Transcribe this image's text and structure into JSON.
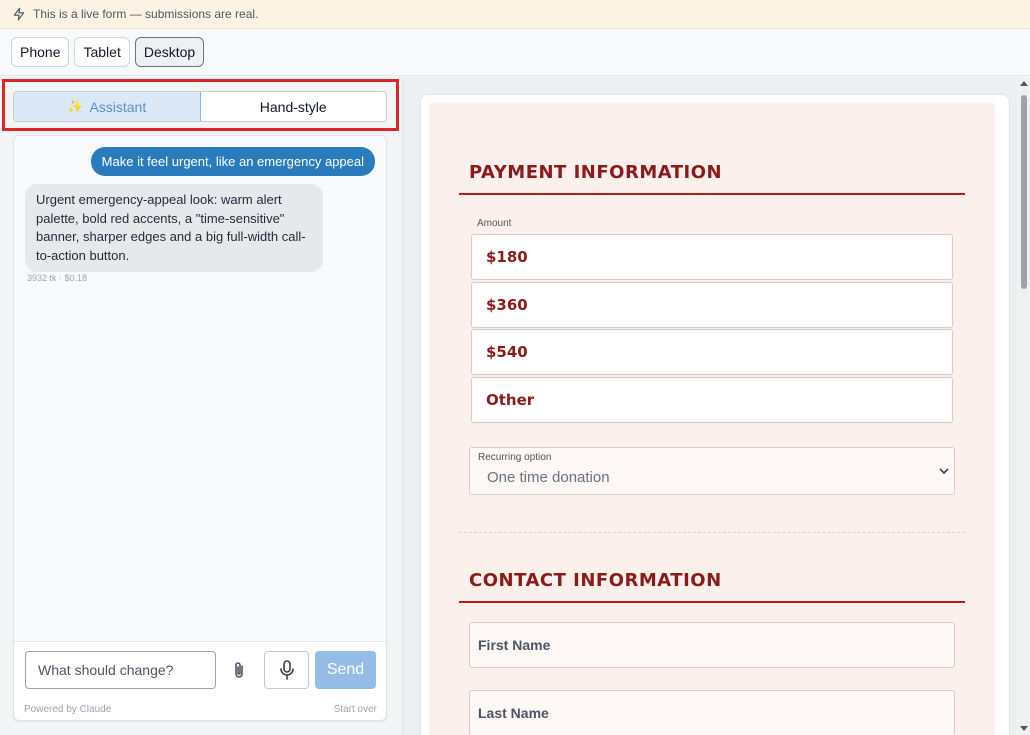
{
  "banner": {
    "icon": "bolt-icon",
    "text": "This is a live form — submissions are real."
  },
  "devices": [
    {
      "label": "Phone",
      "active": false
    },
    {
      "label": "Tablet",
      "active": false
    },
    {
      "label": "Desktop",
      "active": true
    }
  ],
  "panel_tabs": {
    "assistant": "Assistant",
    "handstyle": "Hand-style",
    "active": "assistant"
  },
  "chat": {
    "user_message": "Make it feel urgent, like an emergency appeal",
    "assistant_message": "Urgent emergency-appeal look: warm alert palette, bold red accents, a \"time-sensitive\" banner, sharper edges and a big full-width call-to-action button.",
    "meta": "3932 tk · $0.18"
  },
  "composer": {
    "placeholder": "What should change?",
    "send_label": "Send",
    "powered_by": "Powered by Claude",
    "start_over": "Start over"
  },
  "form": {
    "payment_title": "PAYMENT INFORMATION",
    "amount_label": "Amount",
    "amounts": [
      "$180",
      "$360",
      "$540",
      "Other"
    ],
    "recurring_label": "Recurring option",
    "recurring_value": "One time donation",
    "contact_title": "CONTACT INFORMATION",
    "first_name_placeholder": "First Name",
    "last_name_placeholder": "Last Name"
  },
  "colors": {
    "accent": "#8b1a1a",
    "rule": "#b91c1c",
    "send": "#94bce6",
    "user_bubble": "#2a7bbd",
    "highlight": "#dc2626"
  }
}
